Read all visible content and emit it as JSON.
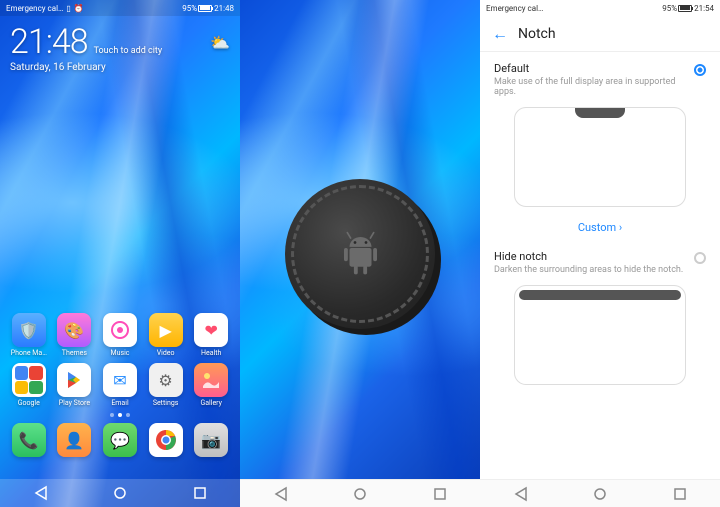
{
  "status": {
    "carrier": "Emergency cal…",
    "battery_pct": "95%",
    "time1": "21:48",
    "time3": "21:54"
  },
  "home": {
    "clock_time": "21:48",
    "touch_city": "Touch to add city",
    "date": "Saturday, 16 February",
    "apps_row1": [
      {
        "label": "Phone Ma…"
      },
      {
        "label": "Themes"
      },
      {
        "label": "Music"
      },
      {
        "label": "Video"
      },
      {
        "label": "Health"
      }
    ],
    "apps_row2": [
      {
        "label": "Google"
      },
      {
        "label": "Play Store"
      },
      {
        "label": "Email"
      },
      {
        "label": "Settings"
      },
      {
        "label": "Gallery"
      }
    ],
    "dock": [
      {
        "label": ""
      },
      {
        "label": ""
      },
      {
        "label": ""
      },
      {
        "label": ""
      },
      {
        "label": ""
      }
    ]
  },
  "settings": {
    "title": "Notch",
    "opt1_title": "Default",
    "opt1_sub": "Make use of the full display area in supported apps.",
    "custom": "Custom",
    "opt2_title": "Hide notch",
    "opt2_sub": "Darken the surrounding areas to hide the notch."
  }
}
